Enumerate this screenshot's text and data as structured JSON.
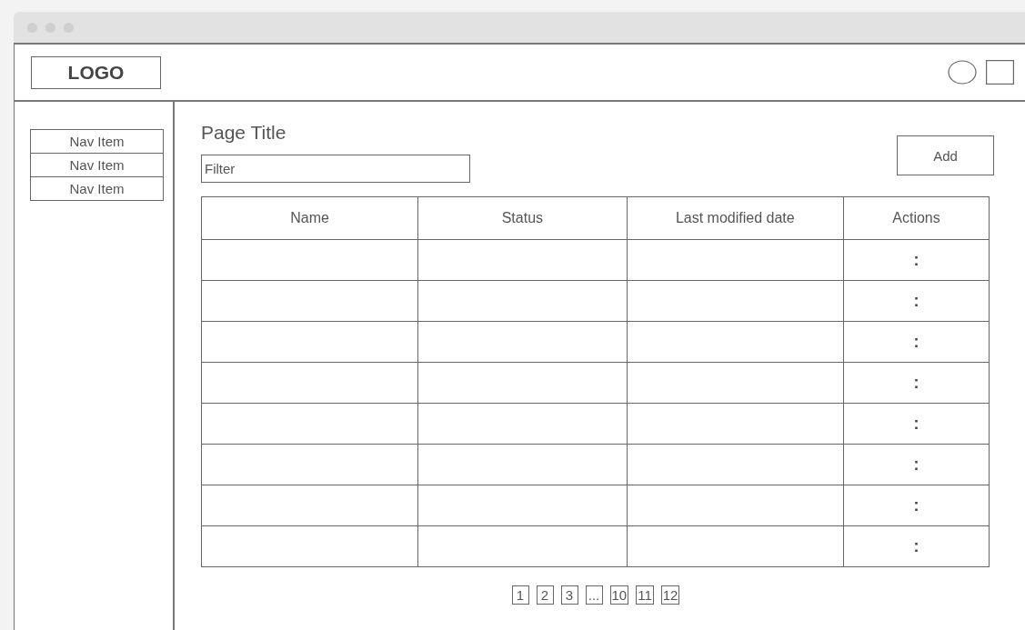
{
  "header": {
    "logo": "LOGO"
  },
  "sidebar": {
    "items": [
      "Nav Item",
      "Nav Item",
      "Nav Item"
    ]
  },
  "main": {
    "title": "Page Title",
    "add_button": "Add",
    "filter": {
      "value": "Filter"
    }
  },
  "table": {
    "columns": [
      "Name",
      "Status",
      "Last modified date",
      "Actions"
    ],
    "rows": [
      {
        "action": ":"
      },
      {
        "action": ":"
      },
      {
        "action": ":"
      },
      {
        "action": ":"
      },
      {
        "action": ":"
      },
      {
        "action": ":"
      },
      {
        "action": ":"
      },
      {
        "action": ":"
      }
    ]
  },
  "pagination": [
    "1",
    "2",
    "3",
    "...",
    "10",
    "11",
    "12"
  ]
}
